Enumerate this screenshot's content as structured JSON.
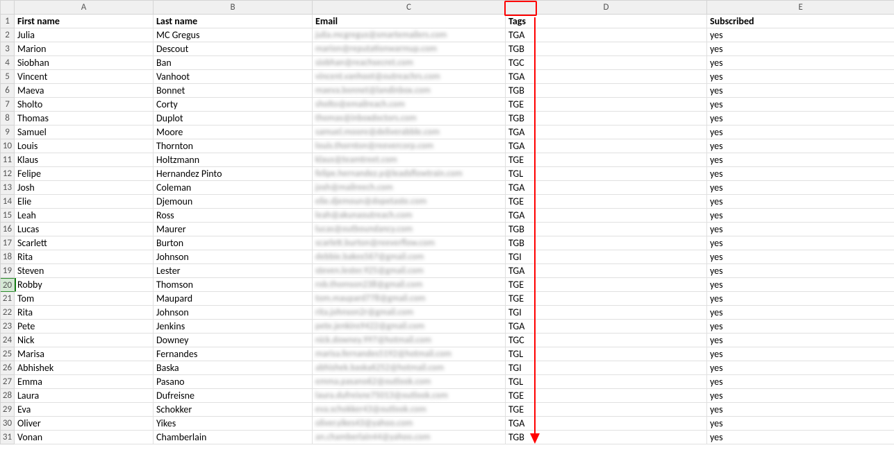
{
  "columns": [
    "A",
    "B",
    "C",
    "D",
    "E"
  ],
  "rows_count": 31,
  "header_row": {
    "A": "First name",
    "B": "Last name",
    "C": "Email",
    "D": "Tags",
    "E": "Subscribed"
  },
  "selected_row": 20,
  "data_rows": [
    {
      "first": "Julia",
      "last": "MC Gregus",
      "email": "julia.mcgregus@smartemailers.com",
      "tag": "TGA",
      "sub": "yes"
    },
    {
      "first": "Marion",
      "last": "Descout",
      "email": "marion@reputationwarmup.com",
      "tag": "TGB",
      "sub": "yes"
    },
    {
      "first": "Siobhan",
      "last": "Ban",
      "email": "siobhan@reachsecret.com",
      "tag": "TGC",
      "sub": "yes"
    },
    {
      "first": "Vincent",
      "last": "Vanhoot",
      "email": "vincent.vanhoot@outreachrs.com",
      "tag": "TGA",
      "sub": "yes"
    },
    {
      "first": "Maeva",
      "last": "Bonnet",
      "email": "maeva.bonnet@landinbox.com",
      "tag": "TGB",
      "sub": "yes"
    },
    {
      "first": "Sholto",
      "last": "Corty",
      "email": "sholto@emailreach.com",
      "tag": "TGE",
      "sub": "yes"
    },
    {
      "first": "Thomas",
      "last": "Duplot",
      "email": "thomas@inboxdoctors.com",
      "tag": "TGB",
      "sub": "yes"
    },
    {
      "first": "Samuel",
      "last": "Moore",
      "email": "samuel.moore@deliverabble.com",
      "tag": "TGA",
      "sub": "yes"
    },
    {
      "first": "Louis",
      "last": "Thornton",
      "email": "louis.thornton@reevercorp.com",
      "tag": "TGA",
      "sub": "yes"
    },
    {
      "first": "Klaus",
      "last": "Holtzmann",
      "email": "klaus@teamtreet.com",
      "tag": "TGE",
      "sub": "yes"
    },
    {
      "first": "Felipe",
      "last": "Hernandez Pinto",
      "email": "felipe.hernandez.p@leadsflowtrain.com",
      "tag": "TGL",
      "sub": "yes"
    },
    {
      "first": "Josh",
      "last": "Coleman",
      "email": "josh@mailreech.com",
      "tag": "TGA",
      "sub": "yes"
    },
    {
      "first": "Elie",
      "last": "Djemoun",
      "email": "elie.djemoun@dopetaste.com",
      "tag": "TGE",
      "sub": "yes"
    },
    {
      "first": "Leah",
      "last": "Ross",
      "email": "leah@akunaoutreach.com",
      "tag": "TGA",
      "sub": "yes"
    },
    {
      "first": "Lucas",
      "last": "Maurer",
      "email": "lucas@outboundancy.com",
      "tag": "TGB",
      "sub": "yes"
    },
    {
      "first": "Scarlett",
      "last": "Burton",
      "email": "scarlett.burton@reeverflow.com",
      "tag": "TGB",
      "sub": "yes"
    },
    {
      "first": "Rita",
      "last": "Johnson",
      "email": "debbie.bakos567@gmail.com",
      "tag": "TGI",
      "sub": "yes"
    },
    {
      "first": "Steven",
      "last": "Lester",
      "email": "steven.lester.925@gmail.com",
      "tag": "TGA",
      "sub": "yes"
    },
    {
      "first": "Robby",
      "last": "Thomson",
      "email": "rob.thomson238@gmail.com",
      "tag": "TGE",
      "sub": "yes"
    },
    {
      "first": "Tom",
      "last": "Maupard",
      "email": "tom.maupard778@gmail.com",
      "tag": "TGE",
      "sub": "yes"
    },
    {
      "first": "Rita",
      "last": "Johnson",
      "email": "rita.johnson2r@gmail.com",
      "tag": "TGI",
      "sub": "yes"
    },
    {
      "first": "Pete",
      "last": "Jenkins",
      "email": "pete.jenkins9422@gmail.com",
      "tag": "TGA",
      "sub": "yes"
    },
    {
      "first": "Nick",
      "last": "Downey",
      "email": "nick.downey.997@hotmail.com",
      "tag": "TGC",
      "sub": "yes"
    },
    {
      "first": "Marisa",
      "last": "Fernandes",
      "email": "marisa.fernandes5192@hotmail.com",
      "tag": "TGL",
      "sub": "yes"
    },
    {
      "first": "Abhishek",
      "last": "Baska",
      "email": "abhishek.baska6252@hotmail.com",
      "tag": "TGI",
      "sub": "yes"
    },
    {
      "first": "Emma",
      "last": "Pasano",
      "email": "emma.pasano62@outlook.com",
      "tag": "TGL",
      "sub": "yes"
    },
    {
      "first": "Laura",
      "last": "Dufreisne",
      "email": "laura.dufreisne75013@outlook.com",
      "tag": "TGE",
      "sub": "yes"
    },
    {
      "first": "Eva",
      "last": "Schokker",
      "email": "eva.schokker43@outlook.com",
      "tag": "TGE",
      "sub": "yes"
    },
    {
      "first": "Oliver",
      "last": "Yikes",
      "email": "oliver.yikes43@yahoo.com",
      "tag": "TGA",
      "sub": "yes"
    },
    {
      "first": "Vonan",
      "last": "Chamberlain",
      "email": "an.chamberlain44@yahoo.com",
      "tag": "TGB",
      "sub": "yes"
    }
  ],
  "annotation": {
    "highlighted_header": "Tags",
    "arrow_direction": "down"
  }
}
